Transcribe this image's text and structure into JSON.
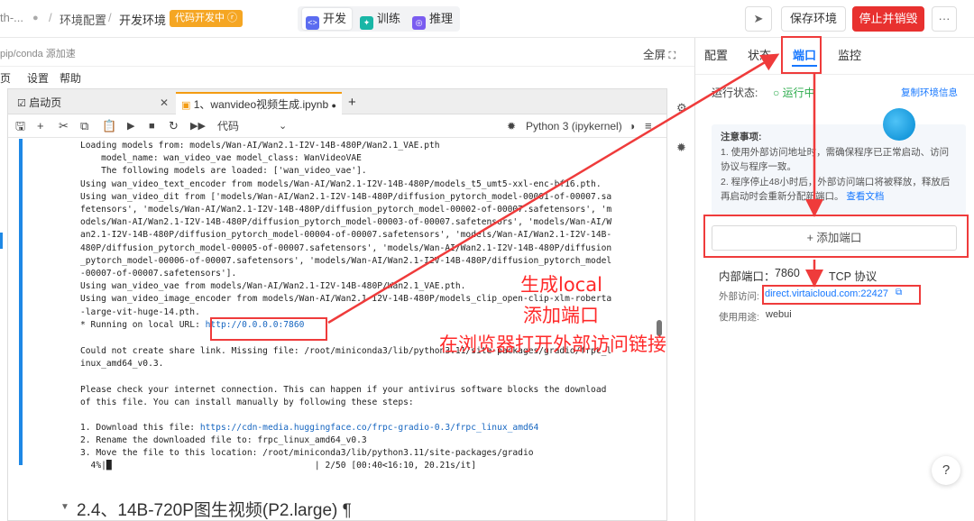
{
  "topbar": {
    "crumb_prefix": "th-...",
    "crumb_env": "环境配置",
    "crumb_page": "开发环境",
    "badge": "代码开发中 ⓡ",
    "modes": [
      "开发",
      "训练",
      "推理"
    ],
    "save_label": "保存环境",
    "stop_label": "停止并销毁",
    "more_label": "···"
  },
  "subbar": {
    "left_text": "pip/conda 源加速",
    "fullscreen": "全屏"
  },
  "menubar": [
    "页",
    "设置",
    "帮助"
  ],
  "notebook": {
    "tab1": "启动页",
    "tab2": "1、wanvideo视频生成.ipynb",
    "cell_type": "代码",
    "kernel": "Python 3 (ipykernel)",
    "output_lines_1": [
      "Loading models from: models/Wan-AI/Wan2.1-I2V-14B-480P/Wan2.1_VAE.pth",
      "    model_name: wan_video_vae model_class: WanVideoVAE",
      "    The following models are loaded: ['wan_video_vae'].",
      "Using wan_video_text_encoder from models/Wan-AI/Wan2.1-I2V-14B-480P/models_t5_umt5-xxl-enc-bf16.pth.",
      "Using wan_video_dit from ['models/Wan-AI/Wan2.1-I2V-14B-480P/diffusion_pytorch_model-00001-of-00007.sa",
      "fetensors', 'models/Wan-AI/Wan2.1-I2V-14B-480P/diffusion_pytorch_model-00002-of-00007.safetensors', 'm",
      "odels/Wan-AI/Wan2.1-I2V-14B-480P/diffusion_pytorch_model-00003-of-00007.safetensors', 'models/Wan-AI/W",
      "an2.1-I2V-14B-480P/diffusion_pytorch_model-00004-of-00007.safetensors', 'models/Wan-AI/Wan2.1-I2V-14B-",
      "480P/diffusion_pytorch_model-00005-of-00007.safetensors', 'models/Wan-AI/Wan2.1-I2V-14B-480P/diffusion",
      "_pytorch_model-00006-of-00007.safetensors', 'models/Wan-AI/Wan2.1-I2V-14B-480P/diffusion_pytorch_model",
      "-00007-of-00007.safetensors'].",
      "Using wan_video_vae from models/Wan-AI/Wan2.1-I2V-14B-480P/Wan2.1_VAE.pth.",
      "Using wan_video_image_encoder from models/Wan-AI/Wan2.1-I2V-14B-480P/models_clip_open-clip-xlm-roberta",
      "-large-vit-huge-14.pth."
    ],
    "local_url_prefix": "* Running on local URL:",
    "local_url": "http://0.0.0.0:7860",
    "output_lines_2": [
      "Could not create share link. Missing file: /root/miniconda3/lib/python3.11/site-packages/gradio/frpc_l",
      "inux_amd64_v0.3.",
      "",
      "Please check your internet connection. This can happen if your antivirus software blocks the download",
      "of this file. You can install manually by following these steps:",
      ""
    ],
    "download_prefix": "1. Download this file: ",
    "download_url": "https://cdn-media.huggingface.co/frpc-gradio-0.3/frpc_linux_amd64",
    "output_lines_3": [
      "2. Rename the downloaded file to: frpc_linux_amd64_v0.3",
      "3. Move the file to this location: /root/miniconda3/lib/python3.11/site-packages/gradio",
      "  4%|█                                       | 2/50 [00:40<16:10, 20.21s/it]"
    ],
    "heading": "2.4、14B-720P图生视频(P2.large) ¶"
  },
  "annotations": {
    "gen_local": "生成local",
    "add_port": "添加端口",
    "open_browser": "在浏览器打开外部访问链接"
  },
  "rightpanel": {
    "tabs": [
      "配置",
      "状态",
      "端口",
      "监控"
    ],
    "status_label": "运行状态:",
    "status_value": "○ 运行中",
    "copy_info": "复制环境信息",
    "notes_title": "注意事项:",
    "notes_lines": [
      "1. 使用外部访问地址时，需确保程序已正常启动、访问",
      "协议与程序一致。",
      "2. 程序停止48小时后，外部访问端口将被释放，释放后",
      "再启动时会重新分配新端口。"
    ],
    "notes_link": "查看文档",
    "add_port_label": "+ 添加端口",
    "inner_port_label": "内部端口：",
    "inner_port_value": "7860",
    "protocol": "TCP 协议",
    "external_label": "外部访问:",
    "external_url": "direct.virtaicloud.com:22427",
    "usage_label": "使用用途:",
    "usage_value": "webui",
    "help_label": "?"
  },
  "colors": {
    "accent_blue": "#1677ff",
    "stop_red": "#e8312f",
    "badge_orange": "#f5a623",
    "annotation_red": "#ff2a2a"
  }
}
